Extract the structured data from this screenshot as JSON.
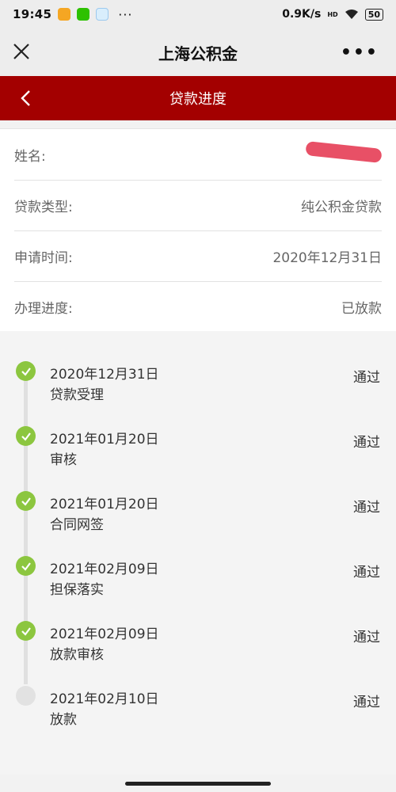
{
  "status_bar": {
    "time": "19:45",
    "more": "···",
    "network_speed": "0.9K/s",
    "hd": "HD",
    "battery": "50"
  },
  "nav": {
    "title": "上海公积金",
    "more": "•••"
  },
  "page": {
    "title": "贷款进度"
  },
  "info": {
    "name_label": "姓名:",
    "loan_type_label": "贷款类型:",
    "loan_type_value": "纯公积金贷款",
    "apply_time_label": "申请时间:",
    "apply_time_value": "2020年12月31日",
    "progress_label": "办理进度:",
    "progress_value": "已放款"
  },
  "steps": [
    {
      "date": "2020年12月31日",
      "name": "贷款受理",
      "status": "通过",
      "done": true
    },
    {
      "date": "2021年01月20日",
      "name": "审核",
      "status": "通过",
      "done": true
    },
    {
      "date": "2021年01月20日",
      "name": "合同网签",
      "status": "通过",
      "done": true
    },
    {
      "date": "2021年02月09日",
      "name": "担保落实",
      "status": "通过",
      "done": true
    },
    {
      "date": "2021年02月09日",
      "name": "放款审核",
      "status": "通过",
      "done": true
    },
    {
      "date": "2021年02月10日",
      "name": "放款",
      "status": "通过",
      "done": false
    }
  ],
  "colors": {
    "header_red": "#a30000",
    "step_done": "#8cc63f",
    "step_pending": "#e2e2e2"
  }
}
